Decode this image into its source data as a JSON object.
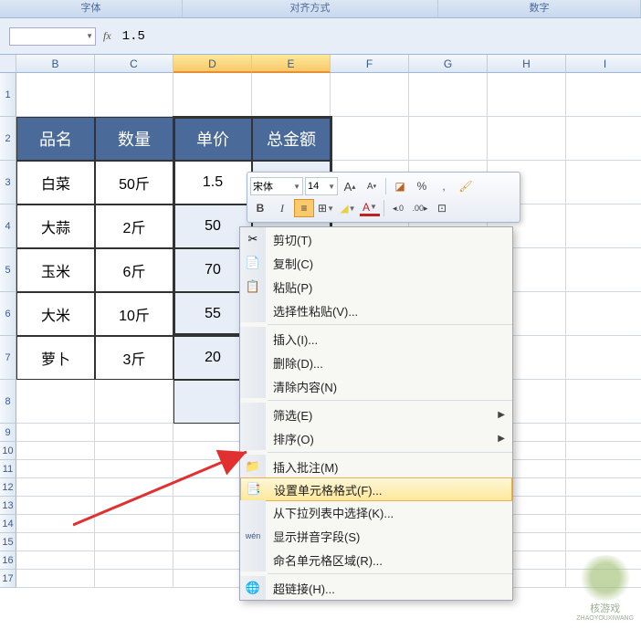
{
  "ribbon": {
    "font_group": "字体",
    "align_group": "对齐方式",
    "number_group": "数字"
  },
  "formula_bar": {
    "fx": "fx",
    "value": "1.5"
  },
  "columns": [
    "B",
    "C",
    "D",
    "E",
    "F",
    "G",
    "H",
    "I"
  ],
  "selected_cols": [
    "D",
    "E"
  ],
  "rows": [
    1,
    2,
    3,
    4,
    5,
    6,
    7,
    8,
    9,
    10,
    11,
    12,
    13,
    14,
    15,
    16,
    17
  ],
  "tall_rows": [
    1,
    2,
    3,
    4,
    5,
    6,
    7,
    8
  ],
  "table": {
    "headers": [
      "品名",
      "数量",
      "单价",
      "总金额"
    ],
    "data": [
      [
        "白菜",
        "50斤",
        "1.5",
        ""
      ],
      [
        "大蒜",
        "2斤",
        "50",
        ""
      ],
      [
        "玉米",
        "6斤",
        "70",
        ""
      ],
      [
        "大米",
        "10斤",
        "55",
        ""
      ],
      [
        "萝卜",
        "3斤",
        "20",
        ""
      ]
    ]
  },
  "mini_toolbar": {
    "font": "宋体",
    "size": "14",
    "grow": "A",
    "shrink": "A",
    "style": "◪",
    "percent": "%",
    "comma": ",",
    "brush": "🖌",
    "bold": "B",
    "italic": "I",
    "center": "≡",
    "border": "⊞",
    "fill": "◢",
    "color": "A",
    "dec_inc": "◂.0",
    "dec_dec": ".00▸",
    "merge": "⊡"
  },
  "context_menu": {
    "cut": "剪切(T)",
    "copy": "复制(C)",
    "paste": "粘贴(P)",
    "paste_special": "选择性粘贴(V)...",
    "insert": "插入(I)...",
    "delete": "删除(D)...",
    "clear": "清除内容(N)",
    "filter": "筛选(E)",
    "sort": "排序(O)",
    "comment": "插入批注(M)",
    "format": "设置单元格格式(F)...",
    "dropdown": "从下拉列表中选择(K)...",
    "pinyin": "显示拼音字段(S)",
    "name": "命名单元格区域(R)...",
    "hyperlink": "超链接(H)..."
  },
  "icons": {
    "cut": "✂",
    "copy": "📄",
    "paste": "📋",
    "comment": "📁",
    "format": "📑",
    "pinyin": "wén",
    "hyperlink": "🌐"
  },
  "watermark": {
    "text1": "核游戏",
    "text2": "ZHAOYOUXIWANG"
  }
}
